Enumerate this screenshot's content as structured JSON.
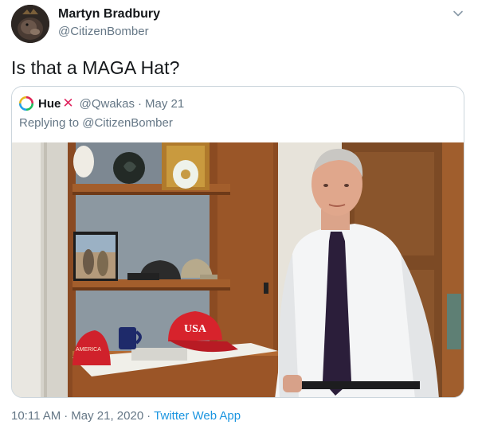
{
  "author": {
    "name": "Martyn Bradbury",
    "handle": "@CitizenBomber"
  },
  "tweet": {
    "text": "Is that a MAGA Hat?"
  },
  "quoted_tweet": {
    "name": "Hue",
    "name_emoji": "✕",
    "handle": "@Qwakas",
    "separator": "·",
    "date": "May 21",
    "reply_text": "Replying to @CitizenBomber",
    "photo": {
      "hat_lettering": "USA",
      "left_hat_lettering": "AMERICA"
    }
  },
  "meta": {
    "time": "10:11 AM",
    "separator": "·",
    "date": "May 21, 2020",
    "app": "Twitter Web App"
  },
  "icons": {
    "caret": "chevron-down-icon"
  },
  "colors": {
    "link": "#1b95e0",
    "secondary_text": "#657786",
    "border": "#ccd6dd",
    "x_emoji": "#e0245e"
  }
}
